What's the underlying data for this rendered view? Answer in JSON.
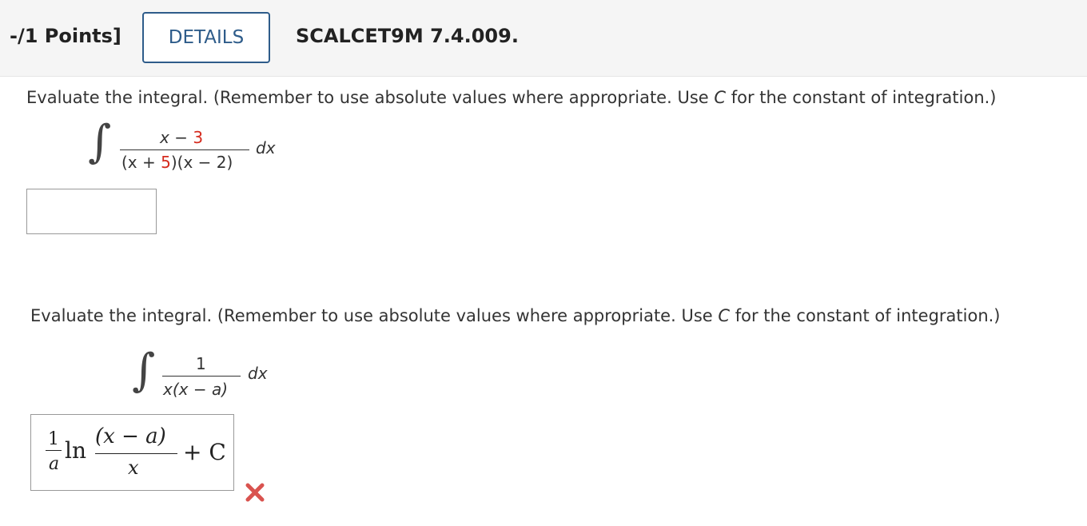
{
  "header": {
    "points": "-/1 Points]",
    "details_label": "DETAILS",
    "problem_id": "SCALCET9M 7.4.009."
  },
  "q1": {
    "instr_before": "Evaluate the integral. (Remember to use absolute values where appropriate. Use ",
    "instr_var": "C",
    "instr_after": " for the constant of integration.)",
    "num_left": "x − ",
    "num_red": "3",
    "den_a": "(x + ",
    "den_red": "5",
    "den_b": ")(x − 2)",
    "dx": "dx",
    "answer": ""
  },
  "q2": {
    "instr_before": "Evaluate the integral. (Remember to use absolute values where appropriate. Use ",
    "instr_var": "C",
    "instr_after": " for the constant of integration.)",
    "num": "1",
    "den": "x(x − a)",
    "dx": "dx",
    "ans_coef_num": "1",
    "ans_coef_den": "a",
    "ans_ln": "ln",
    "ans_num": "(x − a)",
    "ans_den": "x",
    "ans_tail": "+ C"
  },
  "colors": {
    "accent": "#2e5c8a",
    "highlight": "#d52b1e",
    "wrong": "#d9534f"
  },
  "icons": {
    "result": "wrong-x-icon"
  }
}
